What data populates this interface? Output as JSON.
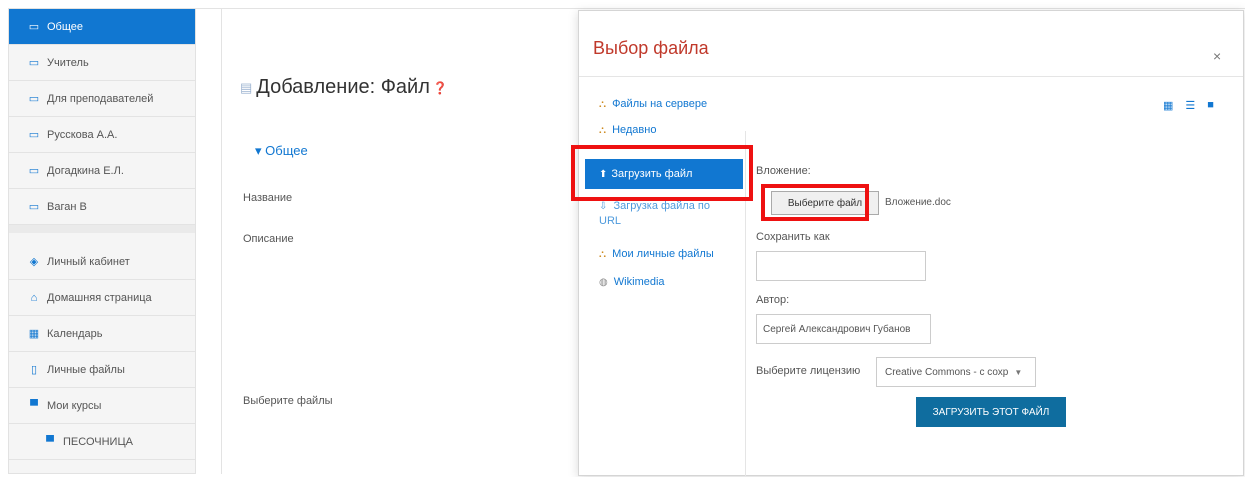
{
  "sidebar": {
    "items": [
      {
        "label": "Общее",
        "icon": "folder-icon"
      },
      {
        "label": "Учитель",
        "icon": "folder-icon"
      },
      {
        "label": "Для преподавателей",
        "icon": "folder-icon"
      },
      {
        "label": "Русскова А.А.",
        "icon": "folder-icon"
      },
      {
        "label": "Догадкина Е.Л.",
        "icon": "folder-icon"
      },
      {
        "label": "Ваган В",
        "icon": "folder-icon"
      },
      {
        "label": "Личный кабинет",
        "icon": "dashboard-icon"
      },
      {
        "label": "Домашняя страница",
        "icon": "home-icon"
      },
      {
        "label": "Календарь",
        "icon": "calendar-icon"
      },
      {
        "label": "Личные файлы",
        "icon": "file-icon"
      },
      {
        "label": "Мои курсы",
        "icon": "graduation-cap-icon"
      },
      {
        "label": "ПЕСОЧНИЦА",
        "icon": "graduation-cap-icon"
      }
    ]
  },
  "main": {
    "title": "Добавление: Файл",
    "section": "Общее",
    "labels": {
      "name": "Название",
      "description": "Описание",
      "select_files": "Выберите файлы"
    }
  },
  "modal": {
    "title": "Выбор файла",
    "close": "×",
    "repositories": [
      {
        "label": "Файлы на сервере",
        "icon": "server-icon"
      },
      {
        "label": "Недавно",
        "icon": "recent-icon"
      },
      {
        "label": "Загрузить файл",
        "icon": "upload-icon"
      },
      {
        "label": "Загрузка файла по URL",
        "icon": "url-icon"
      },
      {
        "label": "Мои личные файлы",
        "icon": "private-files-icon"
      },
      {
        "label": "Wikimedia",
        "icon": "wikimedia-icon"
      }
    ],
    "upload": {
      "attachment_label": "Вложение:",
      "choose_file_button": "Выберите файл",
      "chosen_file": "Вложение.doc",
      "save_as_label": "Сохранить как",
      "save_as_value": "",
      "author_label": "Автор:",
      "author_value": "Сергей Александрович Губанов",
      "license_label": "Выберите лицензию",
      "license_value": "Creative Commons - с сохр",
      "submit_button": "ЗАГРУЗИТЬ ЭТОТ ФАЙЛ"
    }
  },
  "colors": {
    "accent": "#1177d1",
    "modal_title": "#c0392b",
    "highlight_box": "#ee1111",
    "submit_button": "#0f6d9f"
  }
}
